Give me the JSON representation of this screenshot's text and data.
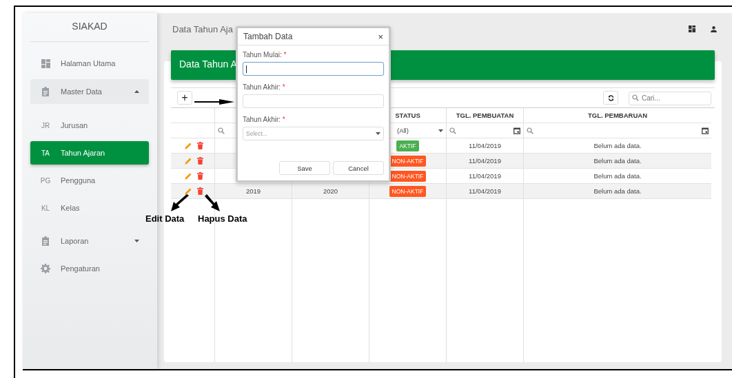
{
  "sidebar": {
    "brand": "SIAKAD",
    "items": [
      {
        "kind": "link",
        "label": "Halaman Utama",
        "selected": false
      },
      {
        "kind": "group",
        "label": "Master Data",
        "selected": false,
        "expanded": true
      },
      {
        "kind": "sub",
        "abbr": "JR",
        "label": "Jurusan",
        "selected": false
      },
      {
        "kind": "sub",
        "abbr": "TA",
        "label": "Tahun Ajaran",
        "selected": true
      },
      {
        "kind": "sub",
        "abbr": "PG",
        "label": "Pengguna",
        "selected": false
      },
      {
        "kind": "sub",
        "abbr": "KL",
        "label": "Kelas",
        "selected": false
      },
      {
        "kind": "group",
        "label": "Laporan",
        "selected": false,
        "expanded": false
      },
      {
        "kind": "link",
        "label": "Pengaturan",
        "selected": false
      }
    ]
  },
  "page_title": "Data Tahun Aja",
  "card": {
    "title": "Data Tahun A",
    "add_button": "+",
    "search": {
      "placeholder": "Cari..."
    },
    "table": {
      "columns": [
        {
          "label": "STATUS"
        },
        {
          "label": "TGL. PEMBUATAN"
        },
        {
          "label": "TGL. PEMBARUAN"
        }
      ],
      "status_filter": "(All)",
      "rows": [
        {
          "status": "AKTIF",
          "color": "#4caf50",
          "created": "11/04/2019",
          "updated": "Belum ada data."
        },
        {
          "status": "NON-AKTIF",
          "color": "#ff5722",
          "created": "11/04/2019",
          "updated": "Belum ada data."
        },
        {
          "status": "NON-AKTIF",
          "color": "#ff5722",
          "created": "11/04/2019",
          "updated": "Belum ada data."
        },
        {
          "column_2": "2019",
          "column_3": "2020",
          "status": "NON-AKTIF",
          "color": "#ff5722",
          "created": "11/04/2019",
          "updated": "Belum ada data."
        }
      ]
    }
  },
  "dialog": {
    "title": "Tambah Data",
    "close": "×",
    "fields": [
      {
        "kind": "text",
        "label": "Tahun Mulai:",
        "required_mark": "*",
        "focused": true
      },
      {
        "kind": "text",
        "label": "Tahun Akhir:",
        "required_mark": "*",
        "focused": false
      },
      {
        "kind": "select",
        "label": "Tahun Akhir:",
        "required_mark": "*",
        "placeholder": "Select...",
        "focused": false
      }
    ],
    "buttons": [
      "Save",
      "Cancel"
    ]
  },
  "annotations": [
    {
      "text": "Edit Data"
    },
    {
      "text": "Hapus Data"
    }
  ]
}
